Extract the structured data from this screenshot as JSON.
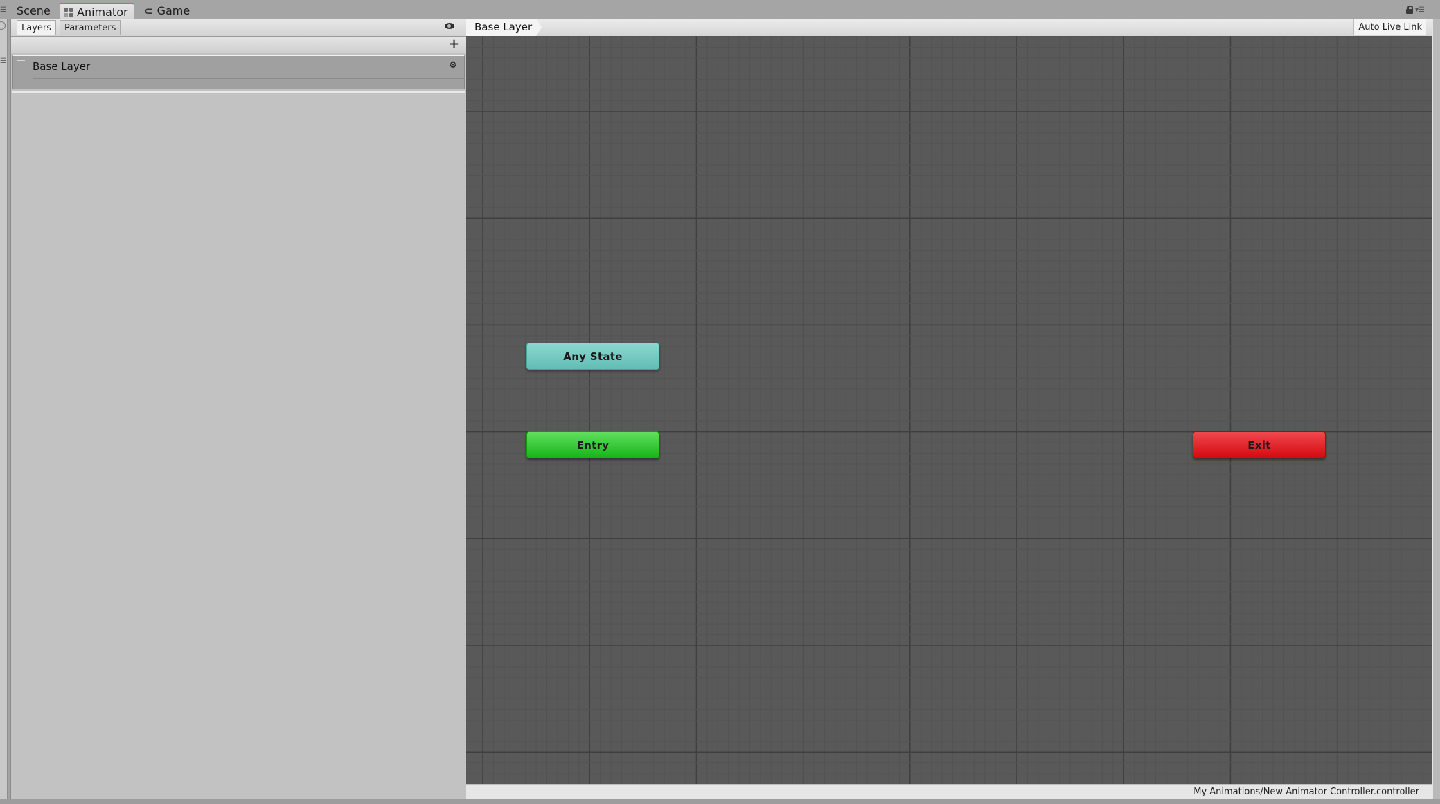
{
  "dock": {
    "tabs": [
      {
        "label": "Scene",
        "icon": "none",
        "active": false
      },
      {
        "label": "Animator",
        "icon": "animator-icon",
        "active": true
      },
      {
        "label": "Game",
        "icon": "game-icon",
        "active": false
      }
    ],
    "right_icons": [
      "lock-icon",
      "options-menu-icon"
    ]
  },
  "layers_panel": {
    "tabs": [
      {
        "label": "Layers",
        "active": true
      },
      {
        "label": "Parameters",
        "active": false
      }
    ],
    "toolbar_icons": [
      "eye-icon",
      "plus-icon"
    ],
    "layers": [
      {
        "name": "Base Layer",
        "icon": "gear-icon"
      }
    ]
  },
  "graph": {
    "breadcrumb": "Base Layer",
    "live_link_label": "Auto Live Link",
    "nodes": [
      {
        "id": "any-state",
        "label": "Any State",
        "color": "#6fc8bf"
      },
      {
        "id": "entry",
        "label": "Entry",
        "color": "#2fc42f"
      },
      {
        "id": "exit",
        "label": "Exit",
        "color": "#e0181e"
      }
    ]
  },
  "status_bar": {
    "asset_path": "My Animations/New Animator Controller.controller"
  },
  "colors": {
    "graph_background": "#595959",
    "active_tab_accent": "#5a8ad0"
  }
}
